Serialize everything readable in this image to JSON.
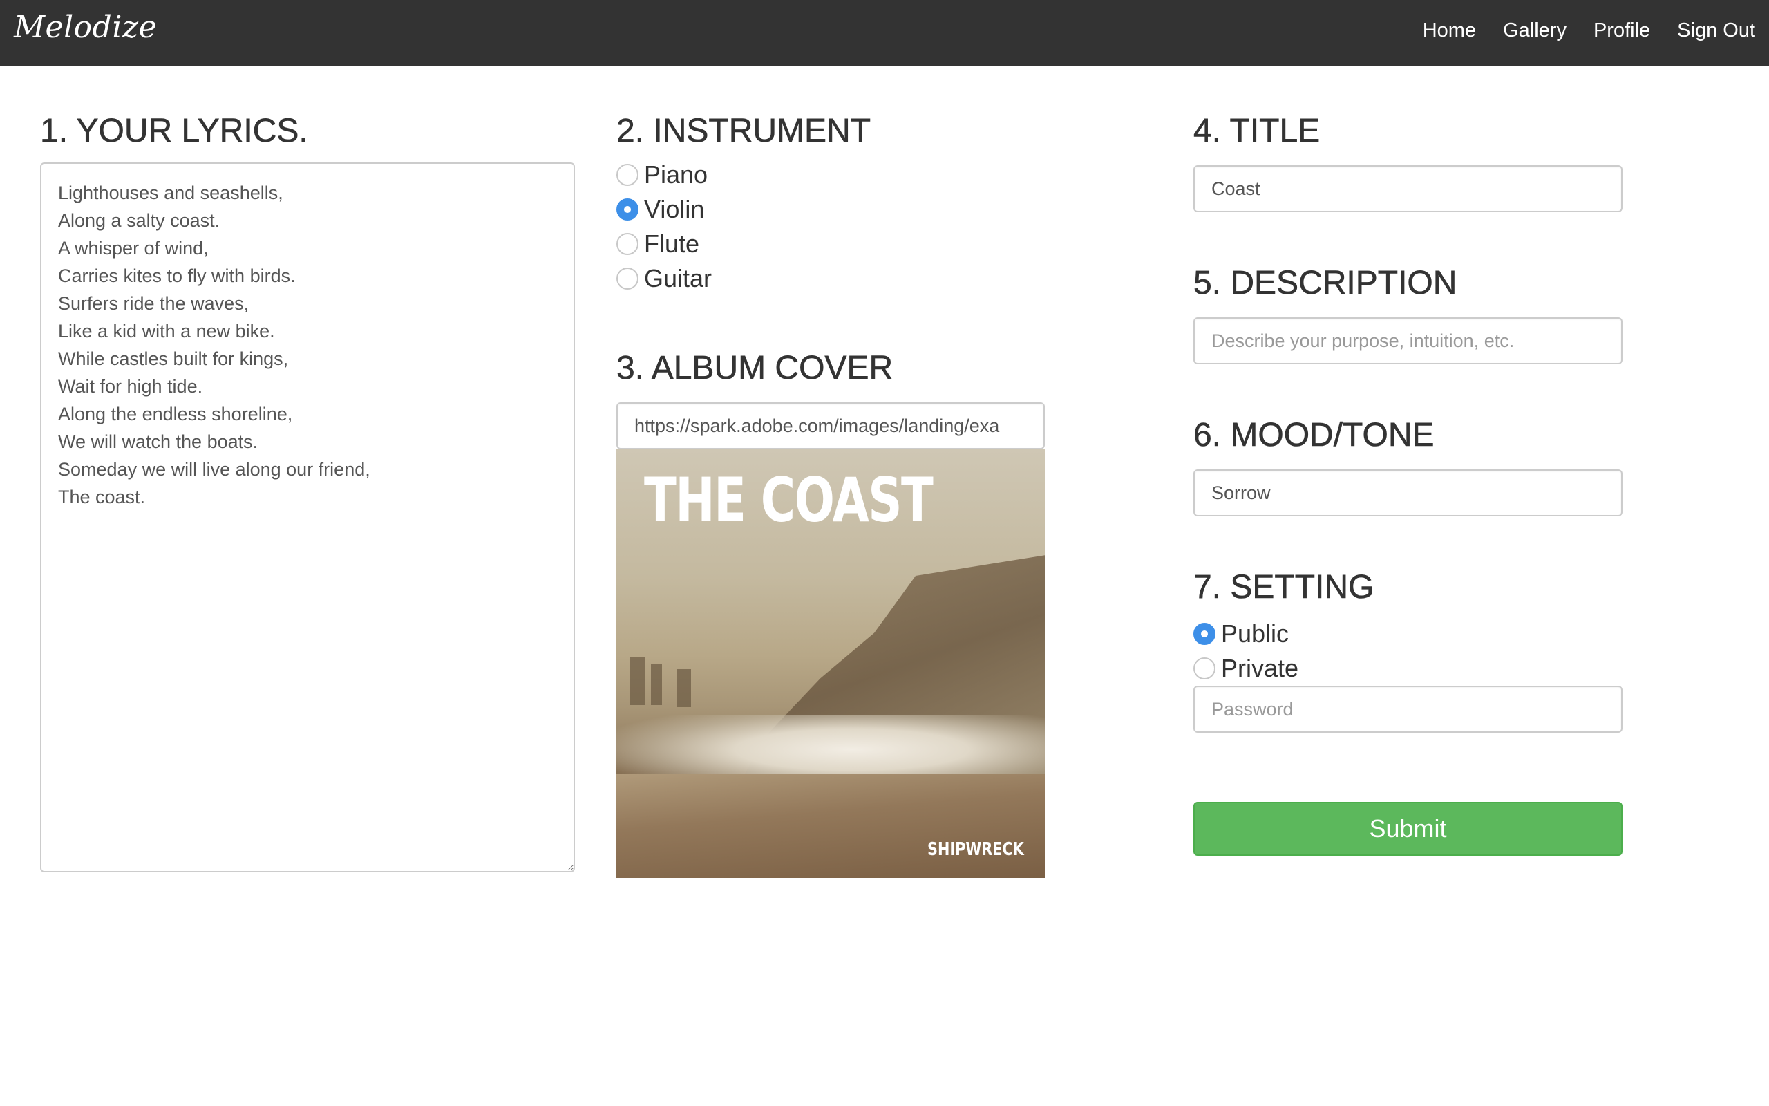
{
  "navbar": {
    "brand": "Melodize",
    "links": [
      "Home",
      "Gallery",
      "Profile",
      "Sign Out"
    ]
  },
  "lyrics": {
    "heading": "1. YOUR LYRICS.",
    "value": "Lighthouses and seashells,\nAlong a salty coast.\nA whisper of wind,\nCarries kites to fly with birds.\nSurfers ride the waves,\nLike a kid with a new bike.\nWhile castles built for kings,\nWait for high tide.\nAlong the endless shoreline,\nWe will watch the boats.\nSomeday we will live along our friend,\nThe coast."
  },
  "instrument": {
    "heading": "2. INSTRUMENT",
    "options": [
      "Piano",
      "Violin",
      "Flute",
      "Guitar"
    ],
    "selected": "Violin"
  },
  "album_cover": {
    "heading": "3. ALBUM COVER",
    "url_value": "https://spark.adobe.com/images/landing/exa",
    "image_title": "THE COAST",
    "image_artist": "SHIPWRECK"
  },
  "title": {
    "heading": "4. TITLE",
    "value": "Coast"
  },
  "description": {
    "heading": "5. DESCRIPTION",
    "value": "",
    "placeholder": "Describe your purpose, intuition, etc."
  },
  "mood": {
    "heading": "6. MOOD/TONE",
    "value": "Sorrow"
  },
  "setting": {
    "heading": "7. SETTING",
    "options": [
      "Public",
      "Private"
    ],
    "selected": "Public",
    "password_placeholder": "Password"
  },
  "submit_label": "Submit",
  "colors": {
    "navbar_bg": "#333333",
    "radio_checked": "#3d8fe8",
    "submit_bg": "#5cb85c"
  }
}
